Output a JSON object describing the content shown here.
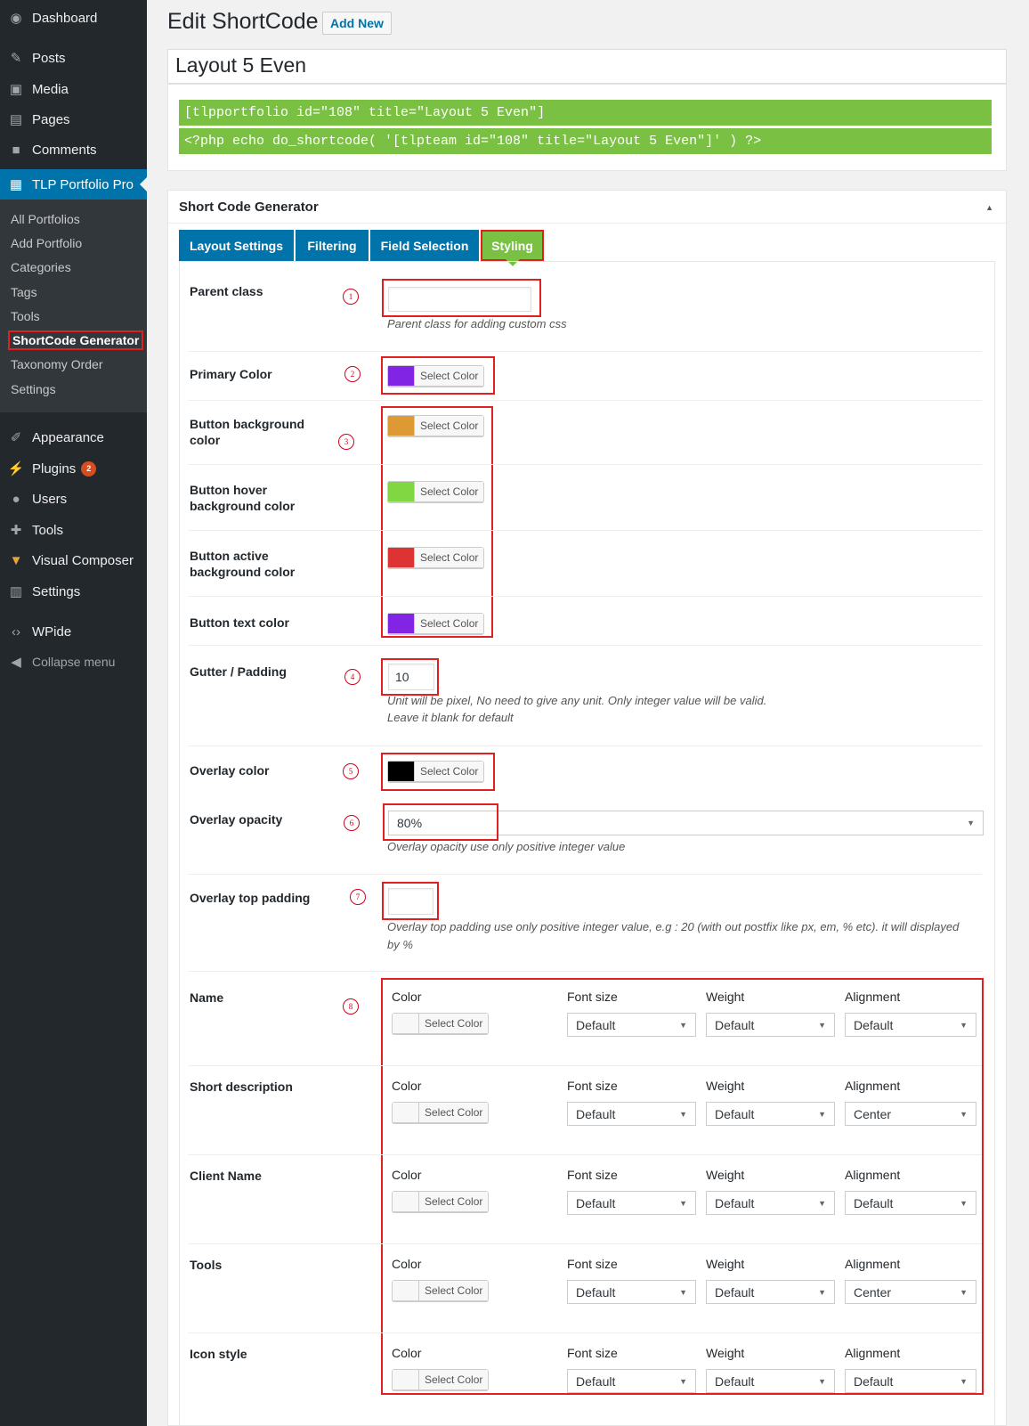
{
  "sidebar": {
    "top": [
      {
        "label": "Dashboard",
        "icon": "dashboard-icon"
      },
      {
        "label": "Posts",
        "icon": "pin-icon"
      },
      {
        "label": "Media",
        "icon": "media-icon"
      },
      {
        "label": "Pages",
        "icon": "pages-icon"
      },
      {
        "label": "Comments",
        "icon": "comment-icon"
      },
      {
        "label": "TLP Portfolio Pro",
        "icon": "portfolio-icon"
      }
    ],
    "sub": [
      "All Portfolios",
      "Add Portfolio",
      "Categories",
      "Tags",
      "Tools",
      "ShortCode Generator",
      "Taxonomy Order",
      "Settings"
    ],
    "bottom": [
      {
        "label": "Appearance",
        "icon": "brush-icon"
      },
      {
        "label": "Plugins",
        "icon": "plugin-icon",
        "badge": "2"
      },
      {
        "label": "Users",
        "icon": "user-icon"
      },
      {
        "label": "Tools",
        "icon": "wrench-icon"
      },
      {
        "label": "Visual Composer",
        "icon": "vc-icon"
      },
      {
        "label": "Settings",
        "icon": "settings-icon"
      },
      {
        "label": "WPide",
        "icon": "code-icon"
      },
      {
        "label": "Collapse menu",
        "icon": "collapse-icon"
      }
    ]
  },
  "header": {
    "title": "Edit ShortCode",
    "add_new": "Add New",
    "post_title": "Layout 5 Even"
  },
  "shortcodes": [
    "[tlpportfolio id=\"108\" title=\"Layout 5 Even\"]",
    "<?php echo do_shortcode( '[tlpteam id=\"108\" title=\"Layout 5 Even\"]' ) ?>"
  ],
  "panel": {
    "title": "Short Code Generator",
    "toggle": "▲",
    "tabs": [
      "Layout Settings",
      "Filtering",
      "Field Selection",
      "Styling"
    ]
  },
  "select_color_label": "Select Color",
  "colors": {
    "primary": "#8224e3",
    "btn_bg": "#dd9933",
    "btn_hover": "#81d742",
    "btn_active": "#dd3333",
    "btn_text": "#8224e3",
    "overlay": "#000000",
    "empty": "#f7f7f7"
  },
  "fields": {
    "parent_class": {
      "label": "Parent class",
      "num": "1",
      "value": "",
      "desc": "Parent class for adding custom css"
    },
    "primary_color": {
      "label": "Primary Color",
      "num": "2"
    },
    "button_bg": {
      "label": "Button background color",
      "num": "3"
    },
    "button_hover": {
      "label": "Button hover background color"
    },
    "button_active": {
      "label": "Button active background color"
    },
    "button_text": {
      "label": "Button text color"
    },
    "gutter": {
      "label": "Gutter / Padding",
      "num": "4",
      "value": "10",
      "desc1": "Unit will be pixel, No need to give any unit. Only integer value will be valid.",
      "desc2": "Leave it blank for default"
    },
    "overlay_color": {
      "label": "Overlay color",
      "num": "5"
    },
    "overlay_opacity": {
      "label": "Overlay opacity",
      "num": "6",
      "value": "80%",
      "desc": "Overlay opacity use only positive integer value"
    },
    "overlay_top": {
      "label": "Overlay top padding",
      "num": "7",
      "value": "",
      "desc1": "Overlay top padding use only positive integer value, e.g : 20 (with out postfix like px, em, % etc). it will displayed",
      "desc2": "by %"
    }
  },
  "typo_num": "8",
  "typo_labels": {
    "color": "Color",
    "font_size": "Font size",
    "weight": "Weight",
    "alignment": "Alignment"
  },
  "typo": [
    {
      "label": "Name",
      "font_size": "Default",
      "weight": "Default",
      "alignment": "Default"
    },
    {
      "label": "Short description",
      "font_size": "Default",
      "weight": "Default",
      "alignment": "Center"
    },
    {
      "label": "Client Name",
      "font_size": "Default",
      "weight": "Default",
      "alignment": "Default"
    },
    {
      "label": "Tools",
      "font_size": "Default",
      "weight": "Default",
      "alignment": "Center"
    },
    {
      "label": "Icon style",
      "font_size": "Default",
      "weight": "Default",
      "alignment": "Default"
    }
  ]
}
